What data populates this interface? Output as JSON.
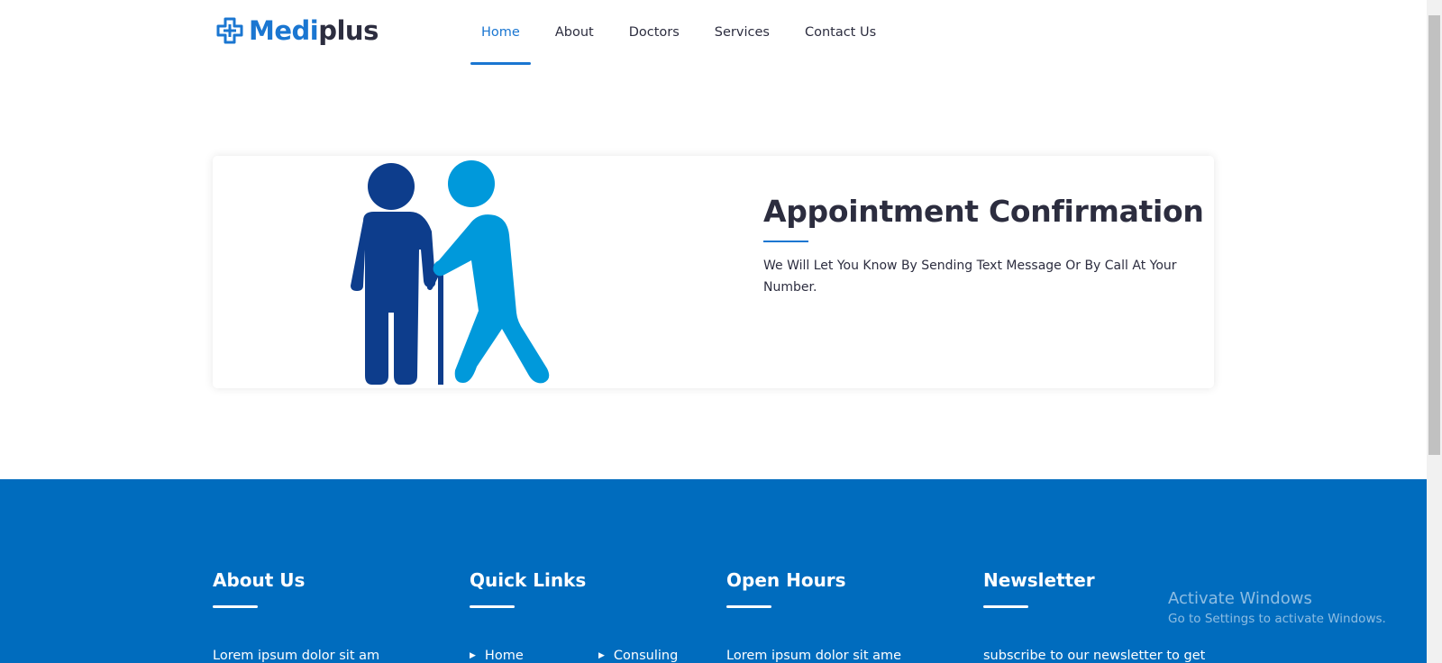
{
  "brand": {
    "medi": "Medi",
    "plus": "plus",
    "primary_color": "#1a76d1"
  },
  "nav": {
    "items": [
      {
        "label": "Home",
        "active": true
      },
      {
        "label": "About",
        "active": false
      },
      {
        "label": "Doctors",
        "active": false
      },
      {
        "label": "Services",
        "active": false
      },
      {
        "label": "Contact Us",
        "active": false
      }
    ]
  },
  "card": {
    "title": "Appointment Confirmation",
    "text": "We Will Let You Know By Sending Text Message Or By Call At Your Number.",
    "illustration_icon": "elderly-person-helped-icon"
  },
  "footer": {
    "background_color": "#006cbe",
    "about": {
      "title": "About Us",
      "text": "Lorem ipsum dolor sit am"
    },
    "quick_links": {
      "title": "Quick Links",
      "links": [
        "Home",
        "Consuling"
      ]
    },
    "open_hours": {
      "title": "Open Hours",
      "text": "Lorem ipsum dolor sit ame"
    },
    "newsletter": {
      "title": "Newsletter",
      "text": "subscribe to our newsletter to get"
    }
  },
  "watermark": {
    "line1": "Activate Windows",
    "line2": "Go to Settings to activate Windows."
  }
}
